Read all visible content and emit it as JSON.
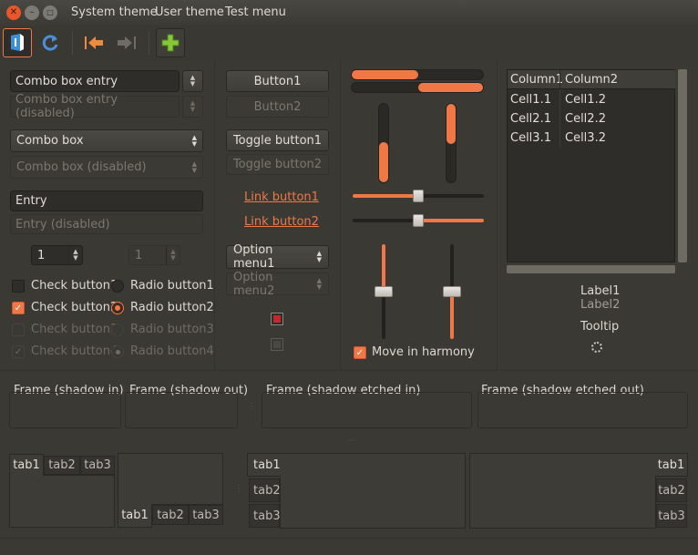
{
  "window": {
    "menu": [
      "System theme",
      "User theme",
      "Test menu"
    ]
  },
  "toolbar": {
    "icons": [
      "app-icon",
      "refresh-icon",
      "back-icon",
      "forward-icon",
      "add-icon"
    ]
  },
  "left": {
    "combo_entry": "Combo box entry",
    "combo_entry_disabled": "Combo box entry (disabled)",
    "combo": "Combo box",
    "combo_disabled": "Combo box (disabled)",
    "entry": "Entry",
    "entry_disabled": "Entry (disabled)",
    "spin1": "1",
    "spin2": "1",
    "check1": "Check button1",
    "check2": "Check button2",
    "check3": "Check button3",
    "check4": "Check button4",
    "radio1": "Radio button1",
    "radio2": "Radio button2",
    "radio3": "Radio button3",
    "radio4": "Radio button4"
  },
  "middle": {
    "button1": "Button1",
    "button2": "Button2",
    "toggle1": "Toggle button1",
    "toggle2": "Toggle button2",
    "link1": "Link button1",
    "link2": "Link button2",
    "option1": "Option menu1",
    "option2": "Option menu2"
  },
  "sliders": {
    "move_in_harmony": "Move in harmony",
    "progress_top": 0.55,
    "progress_second": 0.55,
    "hscale1": 0.5,
    "hscale2": 0.5
  },
  "tree": {
    "columns": [
      "Column1",
      "Column2"
    ],
    "rows": [
      [
        "Cell1.1",
        "Cell1.2"
      ],
      [
        "Cell2.1",
        "Cell2.2"
      ],
      [
        "Cell3.1",
        "Cell3.2"
      ]
    ]
  },
  "right": {
    "label1": "Label1",
    "label2": "Label2",
    "tooltip": "Tooltip"
  },
  "frames": {
    "shadow_in": "Frame (shadow in)",
    "shadow_out": "Frame (shadow out)",
    "etched_in": "Frame (shadow etched in)",
    "etched_out": "Frame (shadow etched out)"
  },
  "tabs": {
    "labels": [
      "tab1",
      "tab2",
      "tab3"
    ]
  },
  "colors": {
    "accent": "#f07746",
    "background": "#3b3934"
  }
}
